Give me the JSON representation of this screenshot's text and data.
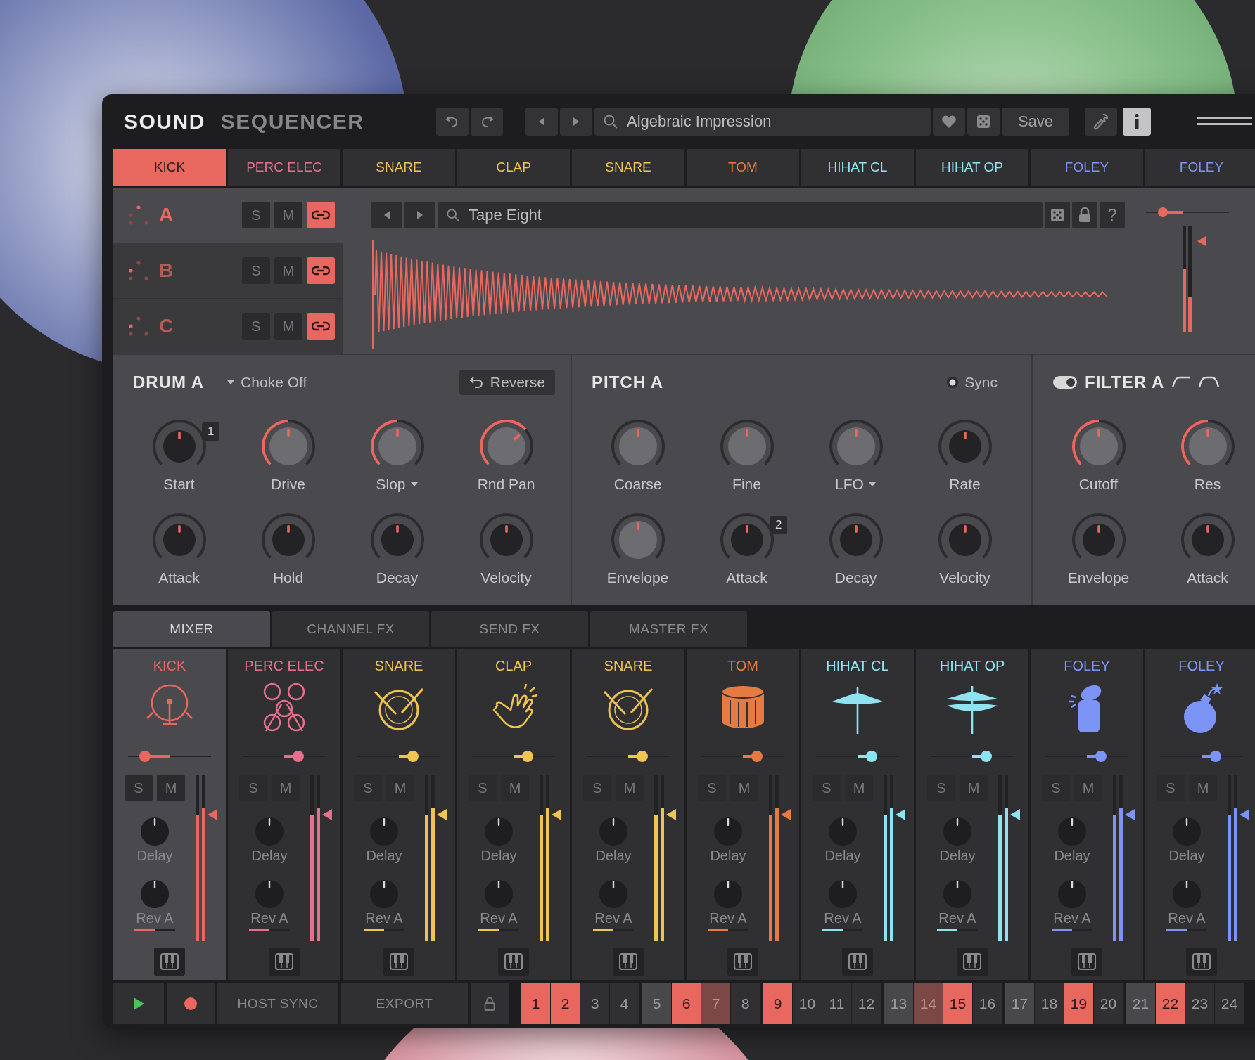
{
  "app": {
    "title": "SOUND",
    "subtitle": "SEQUENCER"
  },
  "preset": {
    "name": "Algebraic Impression",
    "favorite": false,
    "save": "Save"
  },
  "tabs": [
    {
      "label": "KICK",
      "color": "#e8675f",
      "selected": true
    },
    {
      "label": "PERC ELEC",
      "color": "#e6708c",
      "selected": false
    },
    {
      "label": "SNARE",
      "color": "#f0c453",
      "selected": false
    },
    {
      "label": "CLAP",
      "color": "#f0c453",
      "selected": false
    },
    {
      "label": "SNARE",
      "color": "#f0c453",
      "selected": false
    },
    {
      "label": "TOM",
      "color": "#e57b42",
      "selected": false
    },
    {
      "label": "HIHAT CL",
      "color": "#8fe3f0",
      "selected": false
    },
    {
      "label": "HIHAT OP",
      "color": "#8fe3f0",
      "selected": false
    },
    {
      "label": "FOLEY",
      "color": "#7b94f5",
      "selected": false
    },
    {
      "label": "FOLEY",
      "color": "#7b94f5",
      "selected": false
    }
  ],
  "layers": [
    {
      "letter": "A",
      "selected": true,
      "solo": {
        "label": "S",
        "on": false
      },
      "mute": {
        "label": "M",
        "on": false
      },
      "link": true
    },
    {
      "letter": "B",
      "selected": false,
      "solo": {
        "label": "S",
        "on": false
      },
      "mute": {
        "label": "M",
        "on": false
      },
      "link": true
    },
    {
      "letter": "C",
      "selected": false,
      "solo": {
        "label": "S",
        "on": false
      },
      "mute": {
        "label": "M",
        "on": false
      },
      "link": true
    }
  ],
  "sample": {
    "name": "Tape Eight",
    "help": "?",
    "volume": {
      "level": 0.2
    },
    "meter": {
      "level": 0.6
    }
  },
  "panels": [
    {
      "kind": "drum",
      "title": "DRUM A",
      "choke": "Choke Off",
      "reverse": "Reverse",
      "knobs": [
        {
          "label": "Start",
          "kind": "dark",
          "level": 0.5,
          "lit": false,
          "badge": "1"
        },
        {
          "label": "Drive",
          "kind": "light",
          "level": 0.5,
          "lit": true
        },
        {
          "label": "Slop",
          "kind": "light",
          "level": 0.5,
          "lit": true,
          "menu": true
        },
        {
          "label": "Rnd Pan",
          "kind": "light",
          "level": 0.68,
          "lit": true
        },
        {
          "label": "Attack",
          "kind": "dark",
          "level": 0.5,
          "lit": false
        },
        {
          "label": "Hold",
          "kind": "dark",
          "level": 0.5,
          "lit": false
        },
        {
          "label": "Decay",
          "kind": "dark",
          "level": 0.5,
          "lit": false
        },
        {
          "label": "Velocity",
          "kind": "dark",
          "level": 0.5,
          "lit": false
        }
      ]
    },
    {
      "kind": "pitch",
      "title": "PITCH A",
      "sync": {
        "label": "Sync",
        "on": false
      },
      "knobs": [
        {
          "label": "Coarse",
          "kind": "light",
          "level": 0.5,
          "lit": false
        },
        {
          "label": "Fine",
          "kind": "light",
          "level": 0.5,
          "lit": false
        },
        {
          "label": "LFO",
          "kind": "light",
          "level": 0.5,
          "lit": false,
          "menu": true
        },
        {
          "label": "Rate",
          "kind": "dark",
          "level": 0.5,
          "lit": false
        },
        {
          "label": "Envelope",
          "kind": "light",
          "level": 0.5,
          "lit": false
        },
        {
          "label": "Attack",
          "kind": "dark",
          "level": 0.5,
          "lit": false,
          "badge": "2"
        },
        {
          "label": "Decay",
          "kind": "dark",
          "level": 0.5,
          "lit": false
        },
        {
          "label": "Velocity",
          "kind": "dark",
          "level": 0.5,
          "lit": false
        }
      ]
    },
    {
      "kind": "filter",
      "title": "FILTER A",
      "enabled": true,
      "knobs": [
        {
          "label": "Cutoff",
          "kind": "light",
          "level": 0.5,
          "lit": true
        },
        {
          "label": "Res",
          "kind": "light",
          "level": 0.5,
          "lit": true
        },
        {
          "label": "Envelope",
          "kind": "dark",
          "level": 0.5,
          "lit": false
        },
        {
          "label": "Attack",
          "kind": "dark",
          "level": 0.5,
          "lit": false
        }
      ]
    }
  ],
  "mixer_tabs": [
    {
      "label": "MIXER",
      "selected": true
    },
    {
      "label": "CHANNEL FX",
      "selected": false
    },
    {
      "label": "SEND FX",
      "selected": false
    },
    {
      "label": "MASTER FX",
      "selected": false
    }
  ],
  "strips": [
    {
      "name": "KICK",
      "color": "#e8675f",
      "selected": true,
      "pan": {
        "level": 0.2
      },
      "solo": {
        "label": "S",
        "on": false
      },
      "mute": {
        "label": "M",
        "on": false
      },
      "meter": {
        "level": 0.76
      },
      "knobs": [
        {
          "label": "Delay",
          "level": 0.5
        },
        {
          "label": "Rev A",
          "level": 0.5
        }
      ],
      "send": {
        "level": 0.5
      }
    },
    {
      "name": "PERC ELEC",
      "color": "#e6708c",
      "selected": false,
      "pan": {
        "level": 0.67
      },
      "solo": {
        "label": "S",
        "on": false
      },
      "mute": {
        "label": "M",
        "on": false
      },
      "meter": {
        "level": 0.76
      },
      "knobs": [
        {
          "label": "Delay",
          "level": 0.5
        },
        {
          "label": "Rev A",
          "level": 0.5
        }
      ],
      "send": {
        "level": 0.5
      }
    },
    {
      "name": "SNARE",
      "color": "#f0c453",
      "selected": false,
      "pan": {
        "level": 0.67
      },
      "solo": {
        "label": "S",
        "on": false
      },
      "mute": {
        "label": "M",
        "on": false
      },
      "meter": {
        "level": 0.76
      },
      "knobs": [
        {
          "label": "Delay",
          "level": 0.5
        },
        {
          "label": "Rev A",
          "level": 0.5
        }
      ],
      "send": {
        "level": 0.5
      }
    },
    {
      "name": "CLAP",
      "color": "#f0c453",
      "selected": false,
      "pan": {
        "level": 0.67
      },
      "solo": {
        "label": "S",
        "on": false
      },
      "mute": {
        "label": "M",
        "on": false
      },
      "meter": {
        "level": 0.76
      },
      "knobs": [
        {
          "label": "Delay",
          "level": 0.5
        },
        {
          "label": "Rev A",
          "level": 0.5
        }
      ],
      "send": {
        "level": 0.5
      }
    },
    {
      "name": "SNARE",
      "color": "#f0c453",
      "selected": false,
      "pan": {
        "level": 0.67
      },
      "solo": {
        "label": "S",
        "on": false
      },
      "mute": {
        "label": "M",
        "on": false
      },
      "meter": {
        "level": 0.76
      },
      "knobs": [
        {
          "label": "Delay",
          "level": 0.5
        },
        {
          "label": "Rev A",
          "level": 0.5
        }
      ],
      "send": {
        "level": 0.5
      }
    },
    {
      "name": "TOM",
      "color": "#e57b42",
      "selected": false,
      "pan": {
        "level": 0.67
      },
      "solo": {
        "label": "S",
        "on": false
      },
      "mute": {
        "label": "M",
        "on": false
      },
      "meter": {
        "level": 0.76
      },
      "knobs": [
        {
          "label": "Delay",
          "level": 0.5
        },
        {
          "label": "Rev A",
          "level": 0.5
        }
      ],
      "send": {
        "level": 0.5
      }
    },
    {
      "name": "HIHAT CL",
      "color": "#8fe3f0",
      "selected": false,
      "pan": {
        "level": 0.67
      },
      "solo": {
        "label": "S",
        "on": false
      },
      "mute": {
        "label": "M",
        "on": false
      },
      "meter": {
        "level": 0.76
      },
      "knobs": [
        {
          "label": "Delay",
          "level": 0.5
        },
        {
          "label": "Rev A",
          "level": 0.5
        }
      ],
      "send": {
        "level": 0.5
      }
    },
    {
      "name": "HIHAT OP",
      "color": "#8fe3f0",
      "selected": false,
      "pan": {
        "level": 0.67
      },
      "solo": {
        "label": "S",
        "on": false
      },
      "mute": {
        "label": "M",
        "on": false
      },
      "meter": {
        "level": 0.76
      },
      "knobs": [
        {
          "label": "Delay",
          "level": 0.5
        },
        {
          "label": "Rev A",
          "level": 0.5
        }
      ],
      "send": {
        "level": 0.5
      }
    },
    {
      "name": "FOLEY",
      "color": "#7b94f5",
      "selected": false,
      "pan": {
        "level": 0.67
      },
      "solo": {
        "label": "S",
        "on": false
      },
      "mute": {
        "label": "M",
        "on": false
      },
      "meter": {
        "level": 0.76
      },
      "knobs": [
        {
          "label": "Delay",
          "level": 0.5
        },
        {
          "label": "Rev A",
          "level": 0.5
        }
      ],
      "send": {
        "level": 0.5
      }
    },
    {
      "name": "FOLEY",
      "color": "#7b94f5",
      "selected": false,
      "pan": {
        "level": 0.67
      },
      "solo": {
        "label": "S",
        "on": false
      },
      "mute": {
        "label": "M",
        "on": false
      },
      "meter": {
        "level": 0.76
      },
      "knobs": [
        {
          "label": "Delay",
          "level": 0.5
        },
        {
          "label": "Rev A",
          "level": 0.5
        }
      ],
      "send": {
        "level": 0.5
      }
    }
  ],
  "transport": {
    "host_sync": "HOST SYNC",
    "export": "EXPORT",
    "steps": [
      {
        "label": "1",
        "on": true,
        "dimmed": false
      },
      {
        "label": "2",
        "on": true,
        "dimmed": false
      },
      {
        "label": "3",
        "on": false,
        "dimmed": false
      },
      {
        "label": "4",
        "on": false,
        "dimmed": false
      },
      {
        "label": "5",
        "on": false,
        "dimmed": false
      },
      {
        "label": "6",
        "on": true,
        "dimmed": false
      },
      {
        "label": "7",
        "on": false,
        "dimmed": true
      },
      {
        "label": "8",
        "on": false,
        "dimmed": false
      },
      {
        "label": "9",
        "on": true,
        "dimmed": false
      },
      {
        "label": "10",
        "on": false,
        "dimmed": false
      },
      {
        "label": "11",
        "on": false,
        "dimmed": false
      },
      {
        "label": "12",
        "on": false,
        "dimmed": false
      },
      {
        "label": "13",
        "on": false,
        "dimmed": false
      },
      {
        "label": "14",
        "on": false,
        "dimmed": true
      },
      {
        "label": "15",
        "on": true,
        "dimmed": false
      },
      {
        "label": "16",
        "on": false,
        "dimmed": false
      },
      {
        "label": "17",
        "on": false,
        "dimmed": false
      },
      {
        "label": "18",
        "on": false,
        "dimmed": false
      },
      {
        "label": "19",
        "on": true,
        "dimmed": false
      },
      {
        "label": "20",
        "on": false,
        "dimmed": false
      },
      {
        "label": "21",
        "on": false,
        "dimmed": false
      },
      {
        "label": "22",
        "on": true,
        "dimmed": false
      },
      {
        "label": "23",
        "on": false,
        "dimmed": false
      },
      {
        "label": "24",
        "on": false,
        "dimmed": false
      }
    ]
  }
}
